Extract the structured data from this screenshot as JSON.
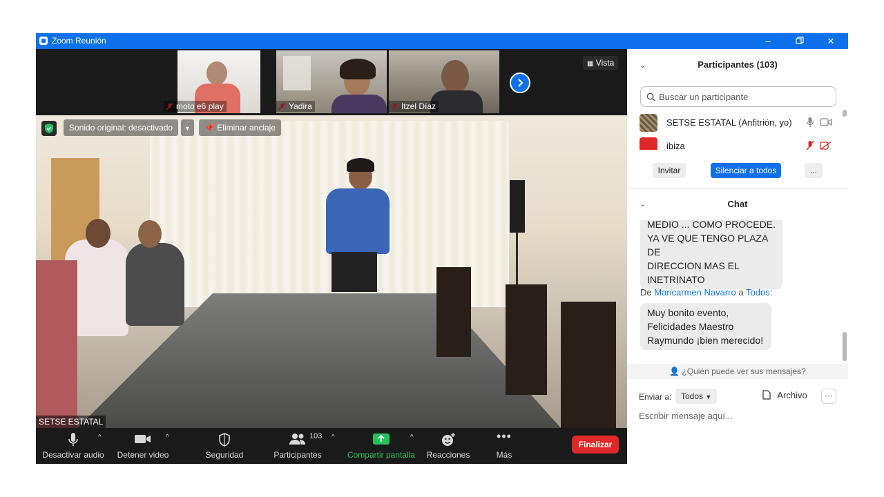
{
  "window": {
    "title": "Zoom Reunión"
  },
  "colors": {
    "accent": "#0e71eb",
    "end": "#e02828",
    "share": "#22c35a"
  },
  "strip": {
    "thumbnails": [
      {
        "name": "moto e6 play"
      },
      {
        "name": "Yadira"
      },
      {
        "name": "Itzel Díaz"
      }
    ],
    "view_label": "Vista"
  },
  "stage": {
    "sound_chip": "Sonido original: desactivado",
    "unpin_chip": "Eliminar anclaje",
    "self_name": "SETSE ESTATAL"
  },
  "toolbar": {
    "mute": "Desactivar audio",
    "video": "Detener video",
    "security": "Seguridad",
    "participants": "Participantes",
    "participants_count": "103",
    "share": "Compartir pantalla",
    "reactions": "Reacciones",
    "more": "Más",
    "end": "Finalizar"
  },
  "participants_panel": {
    "title": "Participantes (103)",
    "search_placeholder": "Buscar un participante",
    "rows": [
      {
        "name": "SETSE ESTATAL (Anfitrión, yo)"
      },
      {
        "name": "ibiza"
      }
    ],
    "invite": "Invitar",
    "mute_all": "Silenciar a todos",
    "more": "..."
  },
  "chat": {
    "title": "Chat",
    "messages": [
      {
        "text_lines": [
          "MEDIO ... COMO PROCEDE.",
          "YA VE QUE TENGO PLAZA DE",
          "DIRECCION MAS EL",
          "INETRINATO"
        ]
      },
      {
        "prefix": "De",
        "from": "Maricarmen Navarro",
        "mid": "a",
        "to": "Todos",
        "suffix": ":",
        "text_lines": [
          "Muy bonito evento,",
          "Felicidades Maestro",
          "Raymundo ¡bien merecido!"
        ]
      }
    ],
    "who_can_see": "¿Quién puede ver sus mensajes?",
    "send_to_label": "Enviar a:",
    "send_to_value": "Todos",
    "file_label": "Archivo",
    "input_placeholder": "Escribir mensaje aquí..."
  }
}
